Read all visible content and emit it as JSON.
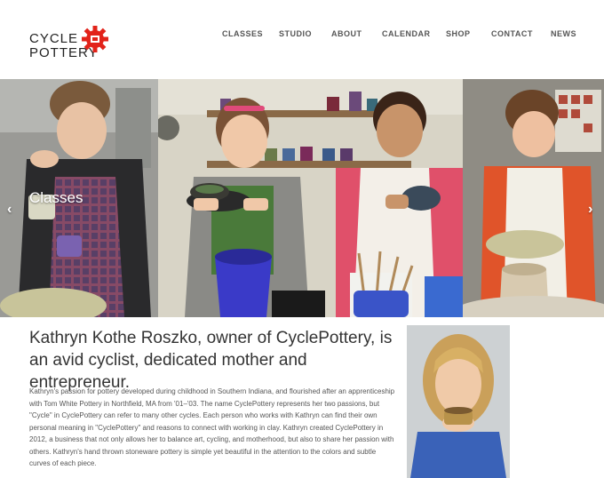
{
  "logo": {
    "line1": "CYCLE",
    "line2": "POTTERY"
  },
  "nav": {
    "items": [
      {
        "label": "CLASSES"
      },
      {
        "label": "STUDIO"
      },
      {
        "label": "ABOUT"
      },
      {
        "label": "CALENDAR"
      },
      {
        "label": "SHOP"
      },
      {
        "label": "CONTACT"
      },
      {
        "label": "NEWS"
      }
    ]
  },
  "hero": {
    "caption": "Classes",
    "prev_icon": "chevron-left-icon",
    "next_icon": "chevron-right-icon"
  },
  "about": {
    "headline": "Kathryn Kothe Roszko, owner of CyclePottery, is an avid cyclist, dedicated mother and entrepreneur.",
    "body": "Kathryn's passion for pottery developed during childhood in Southern Indiana, and flourished after an apprenticeship with Tom White Pottery in Northfield, MA from '01–'03. The name CyclePottery represents her two passions, but \"Cycle\" in CyclePottery can refer to many other cycles. Each person who works with Kathryn can find their own personal meaning in \"CyclePottery\" and reasons to connect with working in clay. Kathryn created CyclePottery in 2012, a business that not only allows her to balance art, cycling, and motherhood, but also to share her passion with others. Kathryn's hand thrown stoneware pottery is simple yet beautiful in the attention to the colors and subtle curves of each piece."
  },
  "colors": {
    "brand_red": "#e2231a",
    "text_dark": "#333333",
    "nav_gray": "#555555"
  }
}
